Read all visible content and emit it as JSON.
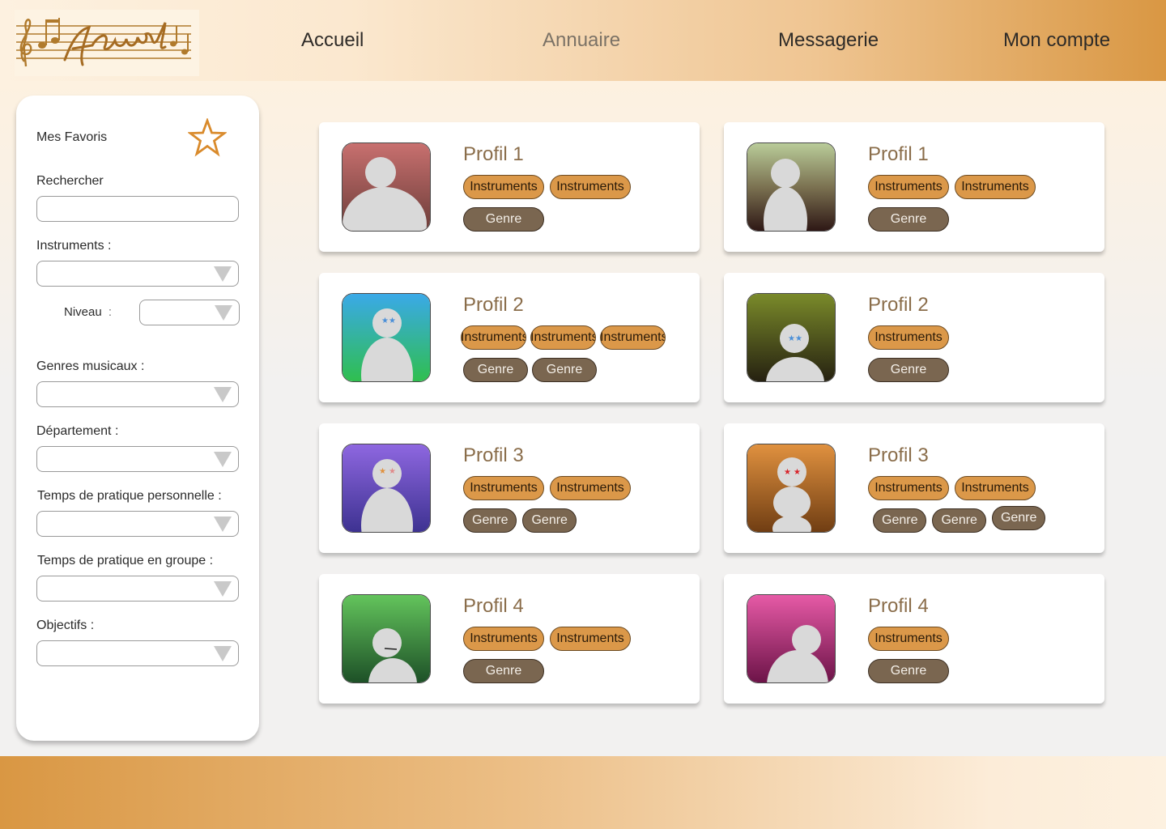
{
  "brand": {
    "name": "Accords"
  },
  "nav": [
    {
      "label": "Accueil",
      "active": false
    },
    {
      "label": "Annuaire",
      "active": true
    },
    {
      "label": "Messagerie",
      "active": false
    },
    {
      "label": "Mon compte",
      "active": false
    }
  ],
  "sidebar": {
    "favorites_label": "Mes Favoris",
    "search_label": "Rechercher",
    "search_value": "",
    "instruments_label": "Instruments :",
    "level_label": "Niveau",
    "level_colon": ":",
    "genres_label": "Genres musicaux :",
    "department_label": "Département :",
    "personal_practice_label": "Temps de pratique personnelle :",
    "group_practice_label": "Temps de pratique en groupe :",
    "objectives_label": "Objectifs :"
  },
  "profiles": [
    {
      "title": "Profil 1",
      "instruments": [
        "Instruments",
        "Instruments"
      ],
      "genres": [
        "Genre"
      ],
      "avatar_colors": [
        "#c8706f",
        "#6a3c38"
      ]
    },
    {
      "title": "Profil 1",
      "instruments": [
        "Instruments",
        "Instruments"
      ],
      "genres": [
        "Genre"
      ],
      "avatar_colors": [
        "#b9cc99",
        "#2b1413"
      ]
    },
    {
      "title": "Profil 2",
      "instruments": [
        "Instruments",
        "Instruments",
        "Instruments"
      ],
      "genres": [
        "Genre",
        "Genre"
      ],
      "avatar_colors": [
        "#3aa9e8",
        "#2fbf4c"
      ]
    },
    {
      "title": "Profil 2",
      "instruments": [
        "Instruments"
      ],
      "genres": [
        "Genre"
      ],
      "avatar_colors": [
        "#7a8a2a",
        "#241f10"
      ]
    },
    {
      "title": "Profil 3",
      "instruments": [
        "Instruments",
        "Instruments"
      ],
      "genres": [
        "Genre",
        "Genre"
      ],
      "avatar_colors": [
        "#8e67e0",
        "#3c3190"
      ]
    },
    {
      "title": "Profil 3",
      "instruments": [
        "Instruments",
        "Instruments"
      ],
      "genres": [
        "Genre",
        "Genre",
        "Genre"
      ],
      "avatar_colors": [
        "#e0913f",
        "#6e3c12"
      ]
    },
    {
      "title": "Profil 4",
      "instruments": [
        "Instruments",
        "Instruments"
      ],
      "genres": [
        "Genre"
      ],
      "avatar_colors": [
        "#63c45c",
        "#1c4e26"
      ]
    },
    {
      "title": "Profil 4",
      "instruments": [
        "Instruments"
      ],
      "genres": [
        "Genre"
      ],
      "avatar_colors": [
        "#e65aa6",
        "#6a1246"
      ]
    }
  ],
  "colors": {
    "accent": "#db9849",
    "genre_tag": "#7a6650",
    "title": "#8a6d4a",
    "star": "#d98a2b"
  }
}
